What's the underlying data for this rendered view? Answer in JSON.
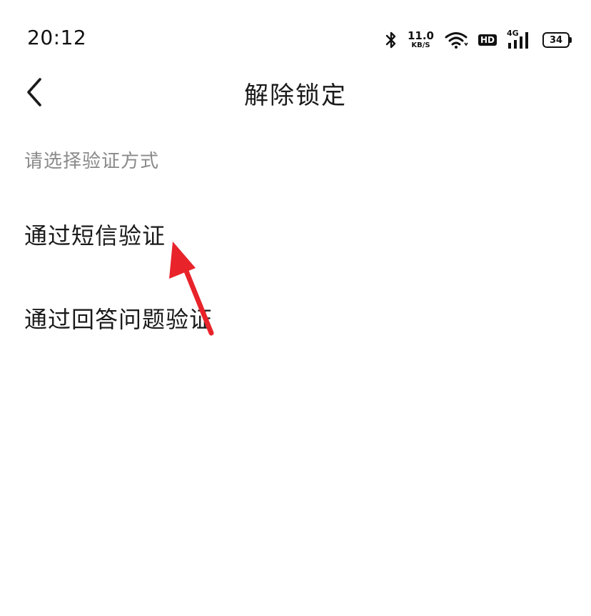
{
  "status_bar": {
    "time": "20:12",
    "net_speed_value": "11.0",
    "net_speed_unit": "KB/S",
    "hd_label": "HD",
    "network_label": "4G",
    "battery_level": "34",
    "icons": [
      "bluetooth-icon",
      "wifi-icon",
      "hd-icon",
      "signal-icon",
      "battery-icon"
    ]
  },
  "header": {
    "title": "解除锁定",
    "back_icon": "chevron-left-icon"
  },
  "main": {
    "hint": "请选择验证方式",
    "options": [
      {
        "label": "通过短信验证"
      },
      {
        "label": "通过回答问题验证"
      }
    ]
  },
  "annotation": {
    "arrow_color": "#e8232a"
  }
}
